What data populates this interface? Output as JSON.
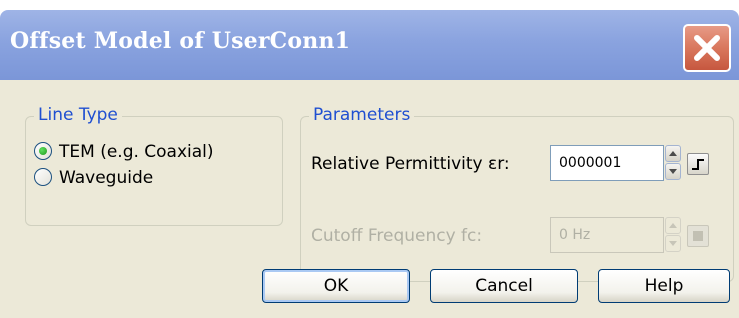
{
  "window": {
    "title": "Offset Model of UserConn1"
  },
  "line_type": {
    "legend": "Line Type",
    "options": [
      {
        "label": "TEM (e.g. Coaxial)",
        "selected": true
      },
      {
        "label": "Waveguide",
        "selected": false
      }
    ]
  },
  "parameters": {
    "legend": "Parameters",
    "permittivity": {
      "label": "Relative Permittivity εr:",
      "value": "0000001",
      "enabled": true
    },
    "cutoff": {
      "label": "Cutoff Frequency fc:",
      "value": "0 Hz",
      "enabled": false
    }
  },
  "buttons": {
    "ok": "OK",
    "cancel": "Cancel",
    "help": "Help"
  },
  "icons": {
    "close": "close-icon",
    "spin_up": "chevron-up-icon",
    "spin_down": "chevron-down-icon",
    "unit": "step-icon"
  },
  "colors": {
    "titlebar": "#8aa3df",
    "close": "#d9775d",
    "legend": "#1f4fd1",
    "dialog_bg": "#ece9d8",
    "radio_dot": "#1f9a1f"
  }
}
